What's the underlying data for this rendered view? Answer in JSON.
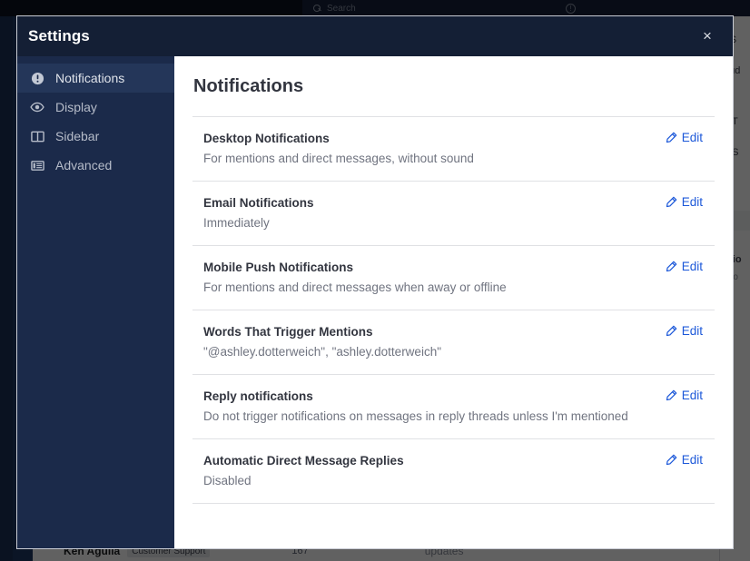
{
  "background": {
    "search_placeholder": "Search",
    "search_icon": "search-icon",
    "help_icon": "help-circle-icon",
    "right_panel_lines": [
      "r S",
      "oud",
      "g T",
      "lf-S",
      "ctio",
      "mo"
    ],
    "post": {
      "author": "Ken Aguila",
      "role_tag": "Customer Support",
      "reply_count": "167",
      "reply_icon": "reply-arrow-icon",
      "updates_text": "updates"
    }
  },
  "modal": {
    "title": "Settings",
    "close_icon": "close-icon",
    "close_label": "×",
    "sidebar": {
      "items": [
        {
          "label": "Notifications",
          "icon": "alert-circle-icon",
          "active": true
        },
        {
          "label": "Display",
          "icon": "eye-icon",
          "active": false
        },
        {
          "label": "Sidebar",
          "icon": "columns-icon",
          "active": false
        },
        {
          "label": "Advanced",
          "icon": "list-panel-icon",
          "active": false
        }
      ]
    },
    "content": {
      "heading": "Notifications",
      "edit_label": "Edit",
      "edit_icon": "pencil-icon",
      "settings": [
        {
          "name": "Desktop Notifications",
          "value": "For mentions and direct messages, without sound"
        },
        {
          "name": "Email Notifications",
          "value": "Immediately"
        },
        {
          "name": "Mobile Push Notifications",
          "value": "For mentions and direct messages when away or offline"
        },
        {
          "name": "Words That Trigger Mentions",
          "value": "\"@ashley.dotterweich\", \"ashley.dotterweich\""
        },
        {
          "name": "Reply notifications",
          "value": "Do not trigger notifications on messages in reply threads unless I'm mentioned"
        },
        {
          "name": "Automatic Direct Message Replies",
          "value": "Disabled"
        }
      ]
    }
  },
  "colors": {
    "header_navy": "#141f35",
    "sidebar_navy": "#1b2a4a",
    "sidebar_active": "#243659",
    "link_blue": "#1c58d9",
    "text_dark": "#32353f",
    "text_muted": "#707480"
  }
}
